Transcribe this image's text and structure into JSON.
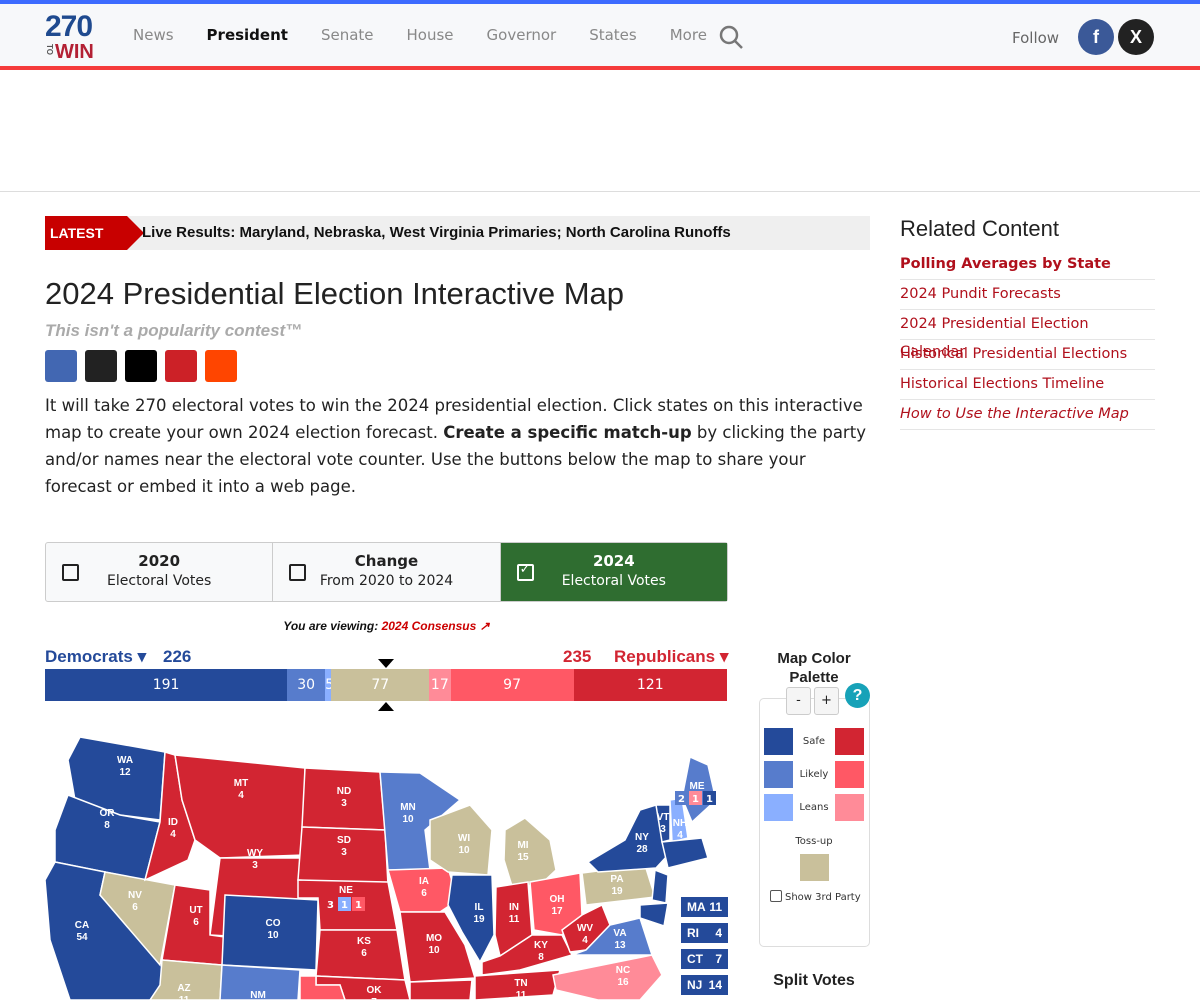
{
  "header": {
    "logo": {
      "number": "270",
      "to": "TO",
      "win": "WIN"
    },
    "nav": [
      "News",
      "President",
      "Senate",
      "House",
      "Governor",
      "States",
      "More"
    ],
    "active_nav": "President",
    "follow_label": "Follow",
    "social": [
      {
        "icon": "facebook-icon",
        "glyph": "f",
        "color": "#3b5998"
      },
      {
        "icon": "x-icon",
        "glyph": "X",
        "color": "#222222"
      }
    ]
  },
  "latest": {
    "tag": "LATEST",
    "text": "Live Results: Maryland, Nebraska, West Virginia Primaries; North Carolina Runoffs"
  },
  "page": {
    "title": "2024 Presidential Election Interactive Map",
    "tagline": "This isn't a popularity contest™",
    "share_colors": [
      "#4267b2",
      "#222222",
      "#000000",
      "#cc2127",
      "#ff4500"
    ],
    "intro_1": "It will take 270 electoral votes to win the 2024 presidential election. Click states on this interactive map to create your own 2024 election forecast. ",
    "intro_bold": "Create a specific match-up",
    "intro_2": " by clicking the party and/or names near the electoral vote counter. Use the buttons below the map to share your forecast or embed it into a web page."
  },
  "modes": [
    {
      "title": "2020",
      "sub": "Electoral Votes",
      "checked": false
    },
    {
      "title": "Change",
      "sub": "From 2020 to 2024",
      "checked": false
    },
    {
      "title": "2024",
      "sub": "Electoral Votes",
      "checked": true
    }
  ],
  "viewing": {
    "label": "You are viewing:",
    "value": "2024 Consensus"
  },
  "counter": {
    "dem_label": "Democrats",
    "dem_total": "226",
    "rep_label": "Republicans",
    "rep_total": "235",
    "segments": [
      {
        "rating": "safe-d",
        "value": 191
      },
      {
        "rating": "likely-d",
        "value": 30
      },
      {
        "rating": "leans-d",
        "value": 5
      },
      {
        "rating": "tossup",
        "value": 77
      },
      {
        "rating": "leans-r",
        "value": 17
      },
      {
        "rating": "likely-r",
        "value": 97
      },
      {
        "rating": "safe-r",
        "value": 121
      }
    ]
  },
  "colors": {
    "safe-d": "#244a9a",
    "likely-d": "#577ccc",
    "leans-d": "#8aafff",
    "tossup": "#c9c09b",
    "leans-r": "#ff8b98",
    "likely-r": "#ff5865",
    "safe-r": "#d22532"
  },
  "states": [
    {
      "abbr": "WA",
      "ev": "12",
      "rating": "safe-d"
    },
    {
      "abbr": "OR",
      "ev": "8",
      "rating": "safe-d"
    },
    {
      "abbr": "CA",
      "ev": "54",
      "rating": "safe-d"
    },
    {
      "abbr": "NV",
      "ev": "6",
      "rating": "tossup"
    },
    {
      "abbr": "ID",
      "ev": "4",
      "rating": "safe-r"
    },
    {
      "abbr": "MT",
      "ev": "4",
      "rating": "safe-r"
    },
    {
      "abbr": "WY",
      "ev": "3",
      "rating": "safe-r"
    },
    {
      "abbr": "UT",
      "ev": "6",
      "rating": "safe-r"
    },
    {
      "abbr": "CO",
      "ev": "10",
      "rating": "safe-d"
    },
    {
      "abbr": "AZ",
      "ev": "11",
      "rating": "tossup"
    },
    {
      "abbr": "NM",
      "ev": "5",
      "rating": "likely-d"
    },
    {
      "abbr": "ND",
      "ev": "3",
      "rating": "safe-r"
    },
    {
      "abbr": "SD",
      "ev": "3",
      "rating": "safe-r"
    },
    {
      "abbr": "NE",
      "ev": "3",
      "rating": "safe-r"
    },
    {
      "abbr": "KS",
      "ev": "6",
      "rating": "safe-r"
    },
    {
      "abbr": "OK",
      "ev": "7",
      "rating": "safe-r"
    },
    {
      "abbr": "TX",
      "ev": "",
      "rating": "likely-r"
    },
    {
      "abbr": "MN",
      "ev": "10",
      "rating": "likely-d"
    },
    {
      "abbr": "IA",
      "ev": "6",
      "rating": "likely-r"
    },
    {
      "abbr": "MO",
      "ev": "10",
      "rating": "safe-r"
    },
    {
      "abbr": "AR",
      "ev": "",
      "rating": "safe-r"
    },
    {
      "abbr": "WI",
      "ev": "10",
      "rating": "tossup"
    },
    {
      "abbr": "MI",
      "ev": "15",
      "rating": "tossup"
    },
    {
      "abbr": "IL",
      "ev": "19",
      "rating": "safe-d"
    },
    {
      "abbr": "IN",
      "ev": "11",
      "rating": "safe-r"
    },
    {
      "abbr": "OH",
      "ev": "17",
      "rating": "likely-r"
    },
    {
      "abbr": "KY",
      "ev": "8",
      "rating": "safe-r"
    },
    {
      "abbr": "TN",
      "ev": "11",
      "rating": "safe-r"
    },
    {
      "abbr": "WV",
      "ev": "4",
      "rating": "safe-r"
    },
    {
      "abbr": "VA",
      "ev": "13",
      "rating": "likely-d"
    },
    {
      "abbr": "NC",
      "ev": "16",
      "rating": "leans-r"
    },
    {
      "abbr": "PA",
      "ev": "19",
      "rating": "tossup"
    },
    {
      "abbr": "NY",
      "ev": "28",
      "rating": "safe-d"
    },
    {
      "abbr": "VT",
      "ev": "3",
      "rating": "safe-d"
    },
    {
      "abbr": "NH",
      "ev": "4",
      "rating": "leans-d"
    },
    {
      "abbr": "ME",
      "ev": "",
      "rating": "likely-d"
    },
    {
      "abbr": "MD",
      "ev": "",
      "rating": "safe-d"
    },
    {
      "abbr": "NJ",
      "ev": "",
      "rating": "safe-d"
    },
    {
      "abbr": "NE-NEW",
      "ev": "",
      "rating": "safe-d"
    }
  ],
  "split_districts": {
    "NE": [
      {
        "ev": "3",
        "rating": "safe-r"
      },
      {
        "ev": "1",
        "rating": "leans-d"
      },
      {
        "ev": "1",
        "rating": "likely-r"
      }
    ],
    "ME": [
      {
        "ev": "2",
        "rating": "likely-d"
      },
      {
        "ev": "1",
        "rating": "leans-r"
      },
      {
        "ev": "1",
        "rating": "safe-d"
      }
    ]
  },
  "small_states": [
    {
      "abbr": "MA",
      "ev": "11"
    },
    {
      "abbr": "RI",
      "ev": "4"
    },
    {
      "abbr": "CT",
      "ev": "7"
    },
    {
      "abbr": "NJ",
      "ev": "14"
    }
  ],
  "palette": {
    "title": "Map Color Palette",
    "minus": "-",
    "plus": "+",
    "help": "?",
    "rows": [
      "Safe",
      "Likely",
      "Leans"
    ],
    "tossup": "Toss-up",
    "show_third": "Show 3rd Party",
    "show_third_checked": false
  },
  "split_votes_title": "Split Votes",
  "related": {
    "title": "Related Content",
    "links": [
      {
        "label": "Polling Averages by State",
        "style": "bold"
      },
      {
        "label": "2024 Pundit Forecasts",
        "style": ""
      },
      {
        "label": "2024 Presidential Election Calendar",
        "style": ""
      },
      {
        "label": "Historical Presidential Elections",
        "style": ""
      },
      {
        "label": "Historical Elections Timeline",
        "style": ""
      },
      {
        "label": "How to Use the Interactive Map",
        "style": "italic"
      }
    ]
  }
}
